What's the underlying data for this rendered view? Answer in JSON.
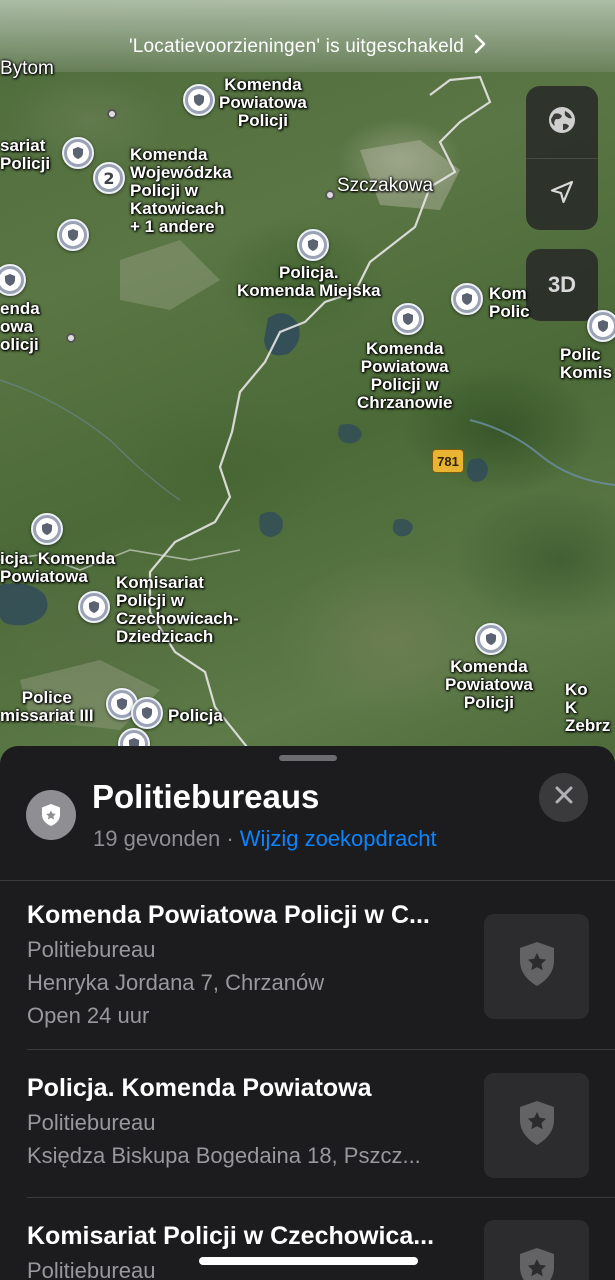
{
  "location_banner": {
    "text": "'Locatievoorzieningen' is uitgeschakeld",
    "chevron_icon": "chevron-right-icon"
  },
  "map_controls": {
    "globe_icon": "globe-icon",
    "location_icon": "location-arrow-icon",
    "three_d_label": "3D"
  },
  "map": {
    "labels": [
      {
        "text": "Bytom"
      },
      {
        "text": "Komenda\nPowiatowa\nPolicji"
      },
      {
        "text": "sariat\nPolicji"
      },
      {
        "text": "Komenda\nWojewódzka\nPolicji w\nKatowicach\n+ 1 andere"
      },
      {
        "text": "Szczakowa"
      },
      {
        "text": "Policja.\nKomenda Miejska"
      },
      {
        "text": "Kom\nPolic"
      },
      {
        "text": "enda\nowa\nolicji"
      },
      {
        "text": "Komenda\nPowiatowa\nPolicji w\nChrzanowie"
      },
      {
        "text": "Polic\nKomis"
      },
      {
        "text": "icja. Komenda\nPowiatowa"
      },
      {
        "text": "Komisariat\nPolicji w\nCzechowicach-\nDziedzicach"
      },
      {
        "text": "Komenda\nPowiatowa\nPolicji"
      },
      {
        "text": "Police\nmissariat III"
      },
      {
        "text": "Policja"
      },
      {
        "text": "Ko\nK\nZebrz"
      }
    ],
    "cluster_count": "2",
    "road_number": "781",
    "accent_color": "#e8b431"
  },
  "sheet": {
    "title": "Politiebureaus",
    "count": "19 gevonden",
    "separator": " · ",
    "edit_link": "Wijzig zoekopdracht",
    "close_icon": "close-icon",
    "link_color": "#0a84ff",
    "results": [
      {
        "name": "Komenda Powiatowa Policji w C...",
        "category": "Politiebureau",
        "address": "Henryka Jordana 7, Chrzanów",
        "hours": "Open 24 uur"
      },
      {
        "name": "Policja. Komenda Powiatowa",
        "category": "Politiebureau",
        "address": "Księdza Biskupa Bogedaina 18, Pszcz..."
      },
      {
        "name": "Komisariat Policji w Czechowica...",
        "category": "Politiebureau"
      }
    ]
  }
}
